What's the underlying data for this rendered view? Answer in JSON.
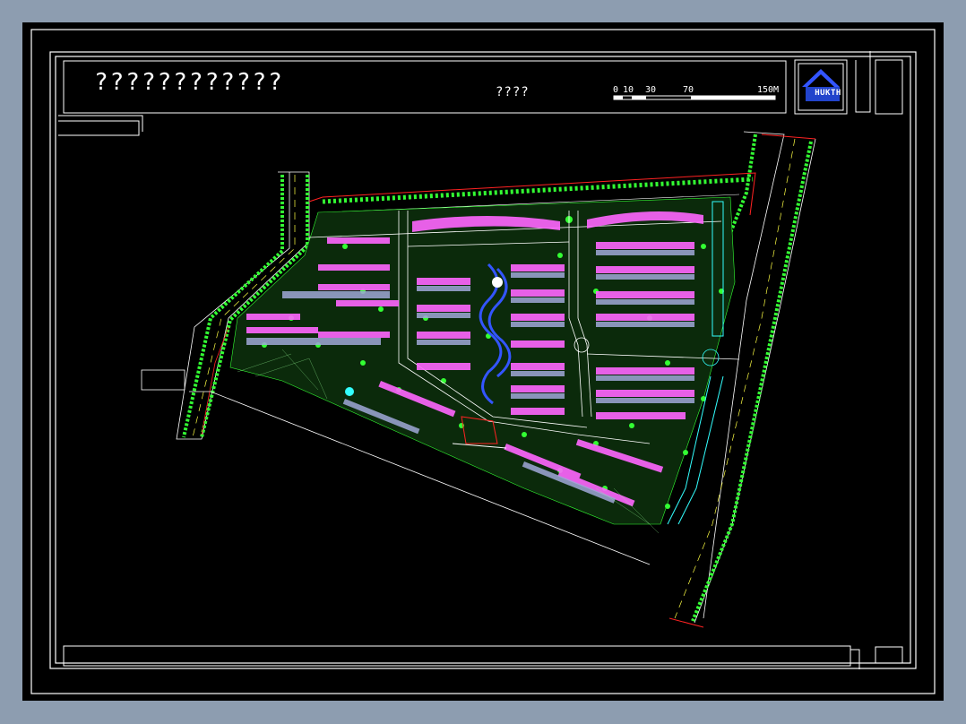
{
  "drawing": {
    "title": "????????????",
    "subtitle": "????"
  },
  "scale_bar": {
    "ticks": [
      "0",
      "10",
      "30",
      "70",
      "150M"
    ]
  },
  "logo": {
    "text": "HUKTH",
    "icon": "house-roof-logo-icon"
  },
  "colors": {
    "background": "#000000",
    "frame": "#ffffff",
    "trees": "#33ff33",
    "buildings_roof": "#ff66ff",
    "buildings_body": "#a0a8d8",
    "water": "#3355ff",
    "boundary": "#ff2222",
    "road_center": "#ffff44",
    "cyan_path": "#33ffff"
  }
}
